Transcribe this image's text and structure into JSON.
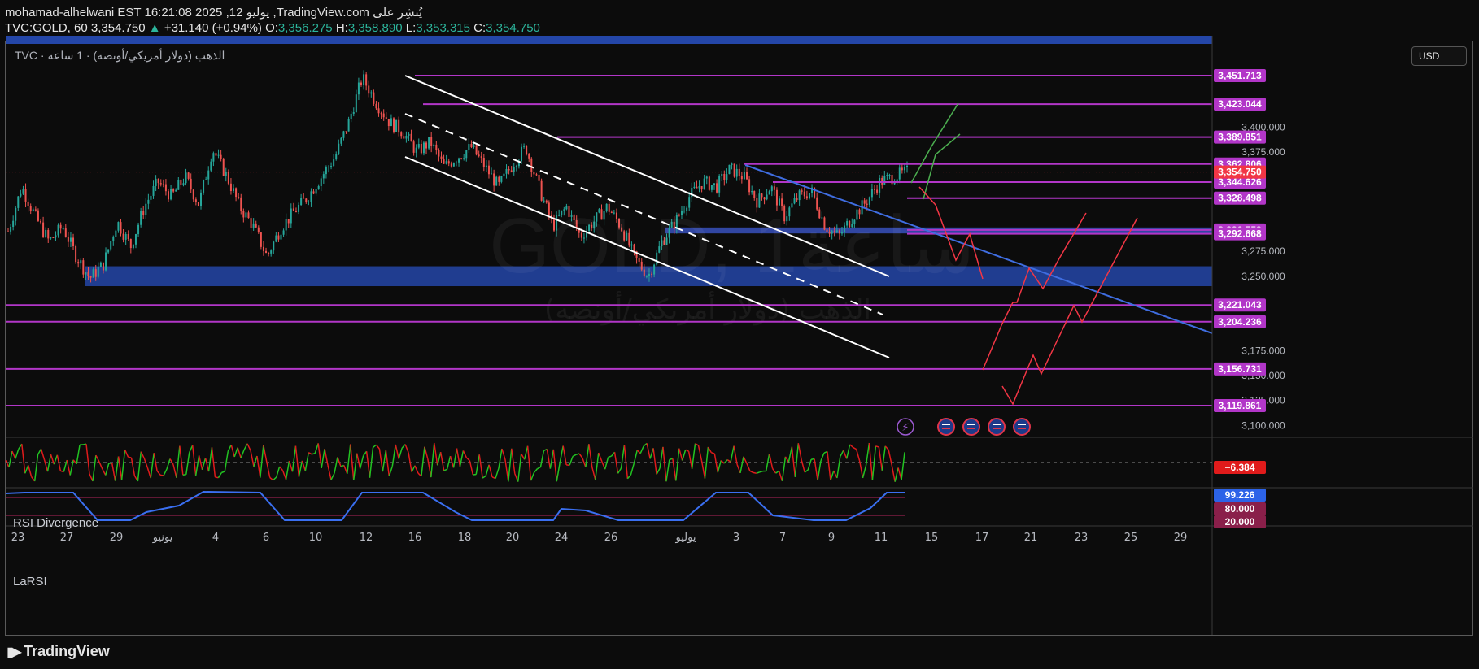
{
  "header": {
    "line1": "mohamad-alhelwani EST 16:21:08 2025 ,12 يوليو ,TradingView.com يُنشِر على",
    "symbol": "TVC:GOLD, 60",
    "last": "3,354.750",
    "change_arrow": "▲",
    "change": "+31.140 (+0.94%)",
    "o_label": "O:",
    "o_val": "3,356.275",
    "h_label": "H:",
    "h_val": "3,358.890",
    "l_label": "L:",
    "l_val": "3,353.315",
    "c_label": "C:",
    "c_val": "3,354.750"
  },
  "chart_legend": "TVC · الذهب (دولار أمريكي/أونصة) · 1 ساعة",
  "currency_button": "USD",
  "watermark": {
    "big": "GOLD, 1ساعة",
    "small": "الذهب (دولار أمريكي/أونصة)"
  },
  "rsi_label": "RSI Divergence",
  "larsi_label": "LaRSI",
  "branding": "TradingView",
  "colors": {
    "background": "#0c0c0c",
    "up": "#2cb59c",
    "magenta_level": "#b236c8",
    "zone_blue": "#2446a8",
    "current_price_tag": "#f23645",
    "projection_green": "#4caf50",
    "projection_red": "#f23645",
    "rsi_up": "#22c322",
    "rsi_down": "#e01b1b",
    "larsi": "#3a6ff0"
  },
  "chart_data": {
    "type": "candlestick",
    "y_axis_ticks": [
      "3,400.000",
      "3,375.000",
      "3,275.000",
      "3,250.000",
      "3,175.000",
      "3,150.000",
      "3,125.000",
      "3,100.000"
    ],
    "horizontal_levels": [
      "3,451.713",
      "3,423.044",
      "3,389.851",
      "3,362.806",
      "3,344.626",
      "3,328.498",
      "3,296.553",
      "3,292.668",
      "3,221.043",
      "3,204.236",
      "3,156.731",
      "3,119.861"
    ],
    "current_price": "3,354.750",
    "support_zone": [
      3240,
      3260
    ],
    "x_labels": [
      "23",
      "27",
      "29",
      "يونيو",
      "4",
      "6",
      "10",
      "12",
      "16",
      "18",
      "20",
      "24",
      "26",
      "يوليو",
      "3",
      "7",
      "9",
      "11",
      "15",
      "17",
      "21",
      "23",
      "25",
      "29"
    ],
    "price_path": [
      3295,
      3340,
      3310,
      3285,
      3300,
      3270,
      3248,
      3262,
      3305,
      3280,
      3320,
      3345,
      3330,
      3350,
      3322,
      3378,
      3352,
      3320,
      3300,
      3270,
      3298,
      3315,
      3330,
      3350,
      3370,
      3405,
      3450,
      3425,
      3405,
      3395,
      3375,
      3385,
      3360,
      3370,
      3380,
      3360,
      3340,
      3362,
      3380,
      3338,
      3300,
      3320,
      3290,
      3305,
      3320,
      3300,
      3268,
      3250,
      3285,
      3305,
      3330,
      3345,
      3340,
      3358,
      3350,
      3325,
      3340,
      3310,
      3330,
      3335,
      3300,
      3290,
      3310,
      3325,
      3345,
      3350,
      3355
    ],
    "rsi": {
      "last_value": "−6.384"
    },
    "larsi": {
      "last_value": "99.226",
      "levels": [
        "80.000",
        "20.000"
      ]
    }
  }
}
